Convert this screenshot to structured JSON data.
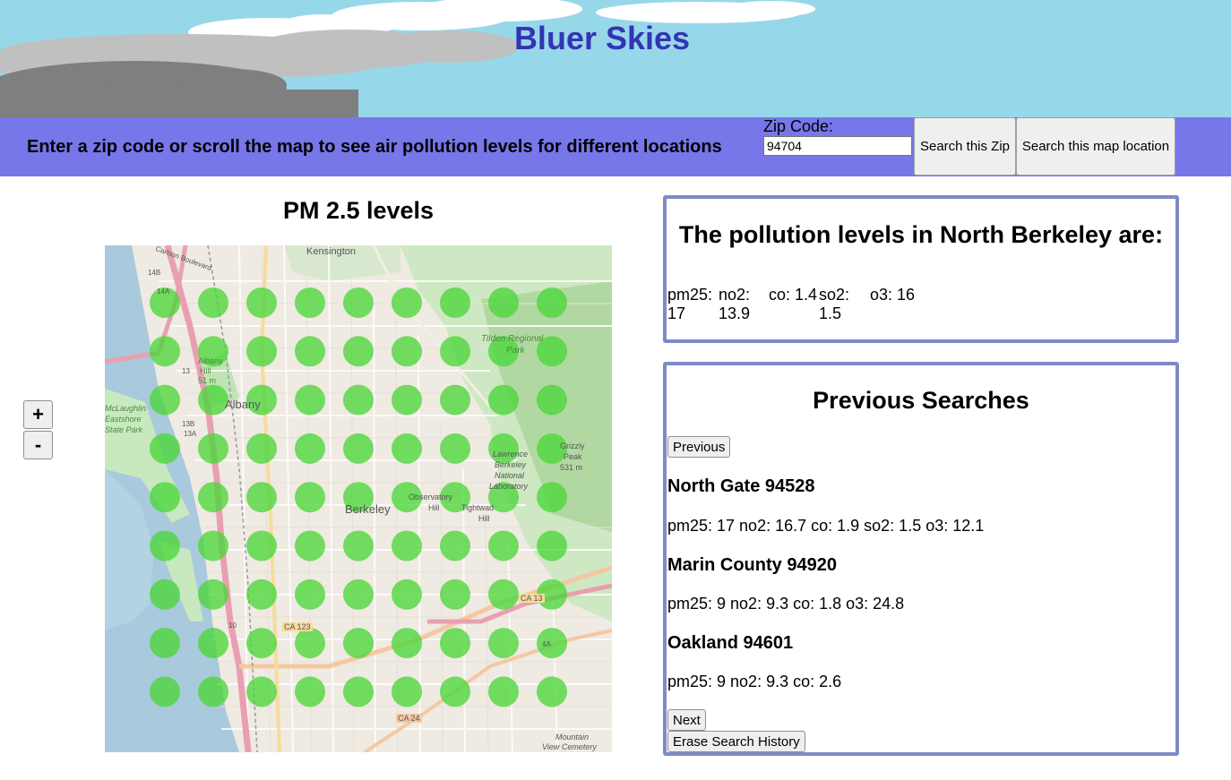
{
  "header": {
    "title": "Bluer Skies"
  },
  "search_bar": {
    "instructions": "Enter a zip code or scroll the map to see air pollution levels for different locations",
    "zip_label": "Zip Code:",
    "zip_value": "94704",
    "search_zip_label": "Search this Zip",
    "search_map_label": "Search this map location"
  },
  "map": {
    "title": "PM 2.5 levels",
    "zoom_in_label": "+",
    "zoom_out_label": "-",
    "dot_color": "#4cd63a",
    "place_labels": {
      "kensington": "Kensington",
      "albany": "Albany",
      "berkeley": "Berkeley",
      "tilden_1": "Tilden Regional",
      "tilden_2": "Park",
      "albany_hill_1": "Albany",
      "albany_hill_2": "Hill",
      "albany_hill_3": "51 m",
      "mclaughlin_1": "McLaughlin",
      "mclaughlin_2": "Eastshore",
      "mclaughlin_3": "State Park",
      "lawrence_1": "Lawrence",
      "lawrence_2": "Berkeley",
      "lawrence_3": "National",
      "lawrence_4": "Laboratory",
      "grizzly_1": "Grizzly",
      "grizzly_2": "Peak",
      "grizzly_3": "531 m",
      "observatory_1": "Observatory",
      "observatory_2": "Hill",
      "tightwad_1": "Tightwad",
      "tightwad_2": "Hill",
      "mountain_1": "Mountain",
      "mountain_2": "View Cemetery",
      "carlson": "Carlson Boulevard",
      "ca13": "CA 13",
      "ca123": "CA 123",
      "ca24": "CA 24",
      "i580_a": "14A",
      "i580_b": "14B",
      "r13": "13",
      "r13b": "13B",
      "r13a": "13A",
      "r10": "10",
      "r4a": "4A"
    }
  },
  "current": {
    "heading": "The pollution levels in North Berkeley are:",
    "values": [
      {
        "label": "pm25:",
        "value": "17"
      },
      {
        "label": "no2:",
        "value": "13.9"
      },
      {
        "label": "co: 1.4",
        "value": ""
      },
      {
        "label": "so2:",
        "value": "1.5"
      },
      {
        "label": "o3: 16",
        "value": ""
      }
    ]
  },
  "history": {
    "heading": "Previous Searches",
    "previous_label": "Previous",
    "next_label": "Next",
    "erase_label": "Erase Search History",
    "entries": [
      {
        "name": "North Gate 94528",
        "values": "pm25: 17 no2: 16.7 co: 1.9 so2: 1.5 o3: 12.1"
      },
      {
        "name": "Marin County 94920",
        "values": "pm25: 9 no2: 9.3 co: 1.8 o3: 24.8"
      },
      {
        "name": "Oakland 94601",
        "values": "pm25: 9 no2: 9.3 co: 2.6"
      }
    ]
  }
}
